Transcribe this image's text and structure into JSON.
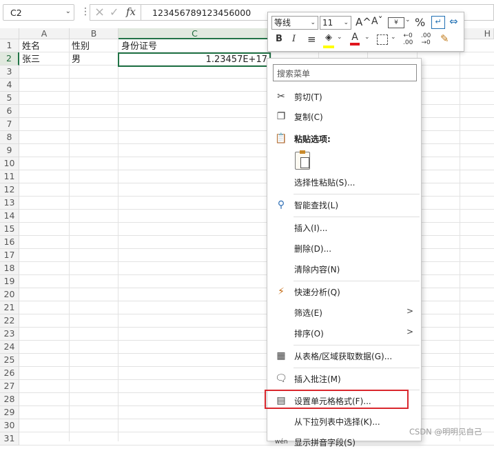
{
  "formula_bar": {
    "name_box": "C2",
    "formula_value": "123456789123456000",
    "cancel_icon": "×",
    "enter_icon": "✓",
    "fx_label": "fx"
  },
  "columns": [
    "A",
    "B",
    "C",
    "H"
  ],
  "rows": [
    "1",
    "2",
    "3",
    "4",
    "5",
    "6",
    "7",
    "8",
    "9",
    "10",
    "11",
    "12",
    "13",
    "14",
    "15",
    "16",
    "17",
    "18",
    "19",
    "20",
    "21",
    "22",
    "23",
    "24",
    "25",
    "26",
    "27",
    "28",
    "29",
    "30",
    "31"
  ],
  "cells": {
    "A1": "姓名",
    "B1": "性别",
    "C1": "身份证号",
    "A2": "张三",
    "B2": "男",
    "C2": "1.23457E+17"
  },
  "mini_toolbar": {
    "font_name": "等线",
    "font_size": "11",
    "grow_font": "A^",
    "shrink_font": "Aˇ",
    "percent": "%",
    "bold": "B",
    "italic": "I",
    "align": "≡",
    "font_color_letter": "A",
    "increase_decimal": "←.0 .00",
    "decrease_decimal": ".00 →.0"
  },
  "context_menu": {
    "search_placeholder": "搜索菜单",
    "items": [
      {
        "label": "剪切(T)",
        "icon": "scissors-icon"
      },
      {
        "label": "复制(C)",
        "icon": "copy-icon"
      },
      {
        "label": "粘贴选项:",
        "icon": "paste-icon"
      },
      {
        "label": "选择性粘贴(S)...",
        "icon": ""
      },
      {
        "label": "智能查找(L)",
        "icon": "smart-lookup-icon"
      },
      {
        "label": "插入(I)...",
        "icon": ""
      },
      {
        "label": "删除(D)...",
        "icon": ""
      },
      {
        "label": "清除内容(N)",
        "icon": ""
      },
      {
        "label": "快速分析(Q)",
        "icon": "quick-analysis-icon"
      },
      {
        "label": "筛选(E)",
        "icon": ""
      },
      {
        "label": "排序(O)",
        "icon": ""
      },
      {
        "label": "从表格/区域获取数据(G)...",
        "icon": "table-icon"
      },
      {
        "label": "插入批注(M)",
        "icon": "comment-icon"
      },
      {
        "label": "设置单元格格式(F)...",
        "icon": "format-cells-icon"
      },
      {
        "label": "从下拉列表中选择(K)...",
        "icon": ""
      },
      {
        "label": "显示拼音字段(S)",
        "icon": "phonetic-icon"
      }
    ]
  },
  "colors": {
    "excel_green": "#217346",
    "highlight_red": "#d9262c"
  },
  "watermark": "CSDN @明明见自己"
}
